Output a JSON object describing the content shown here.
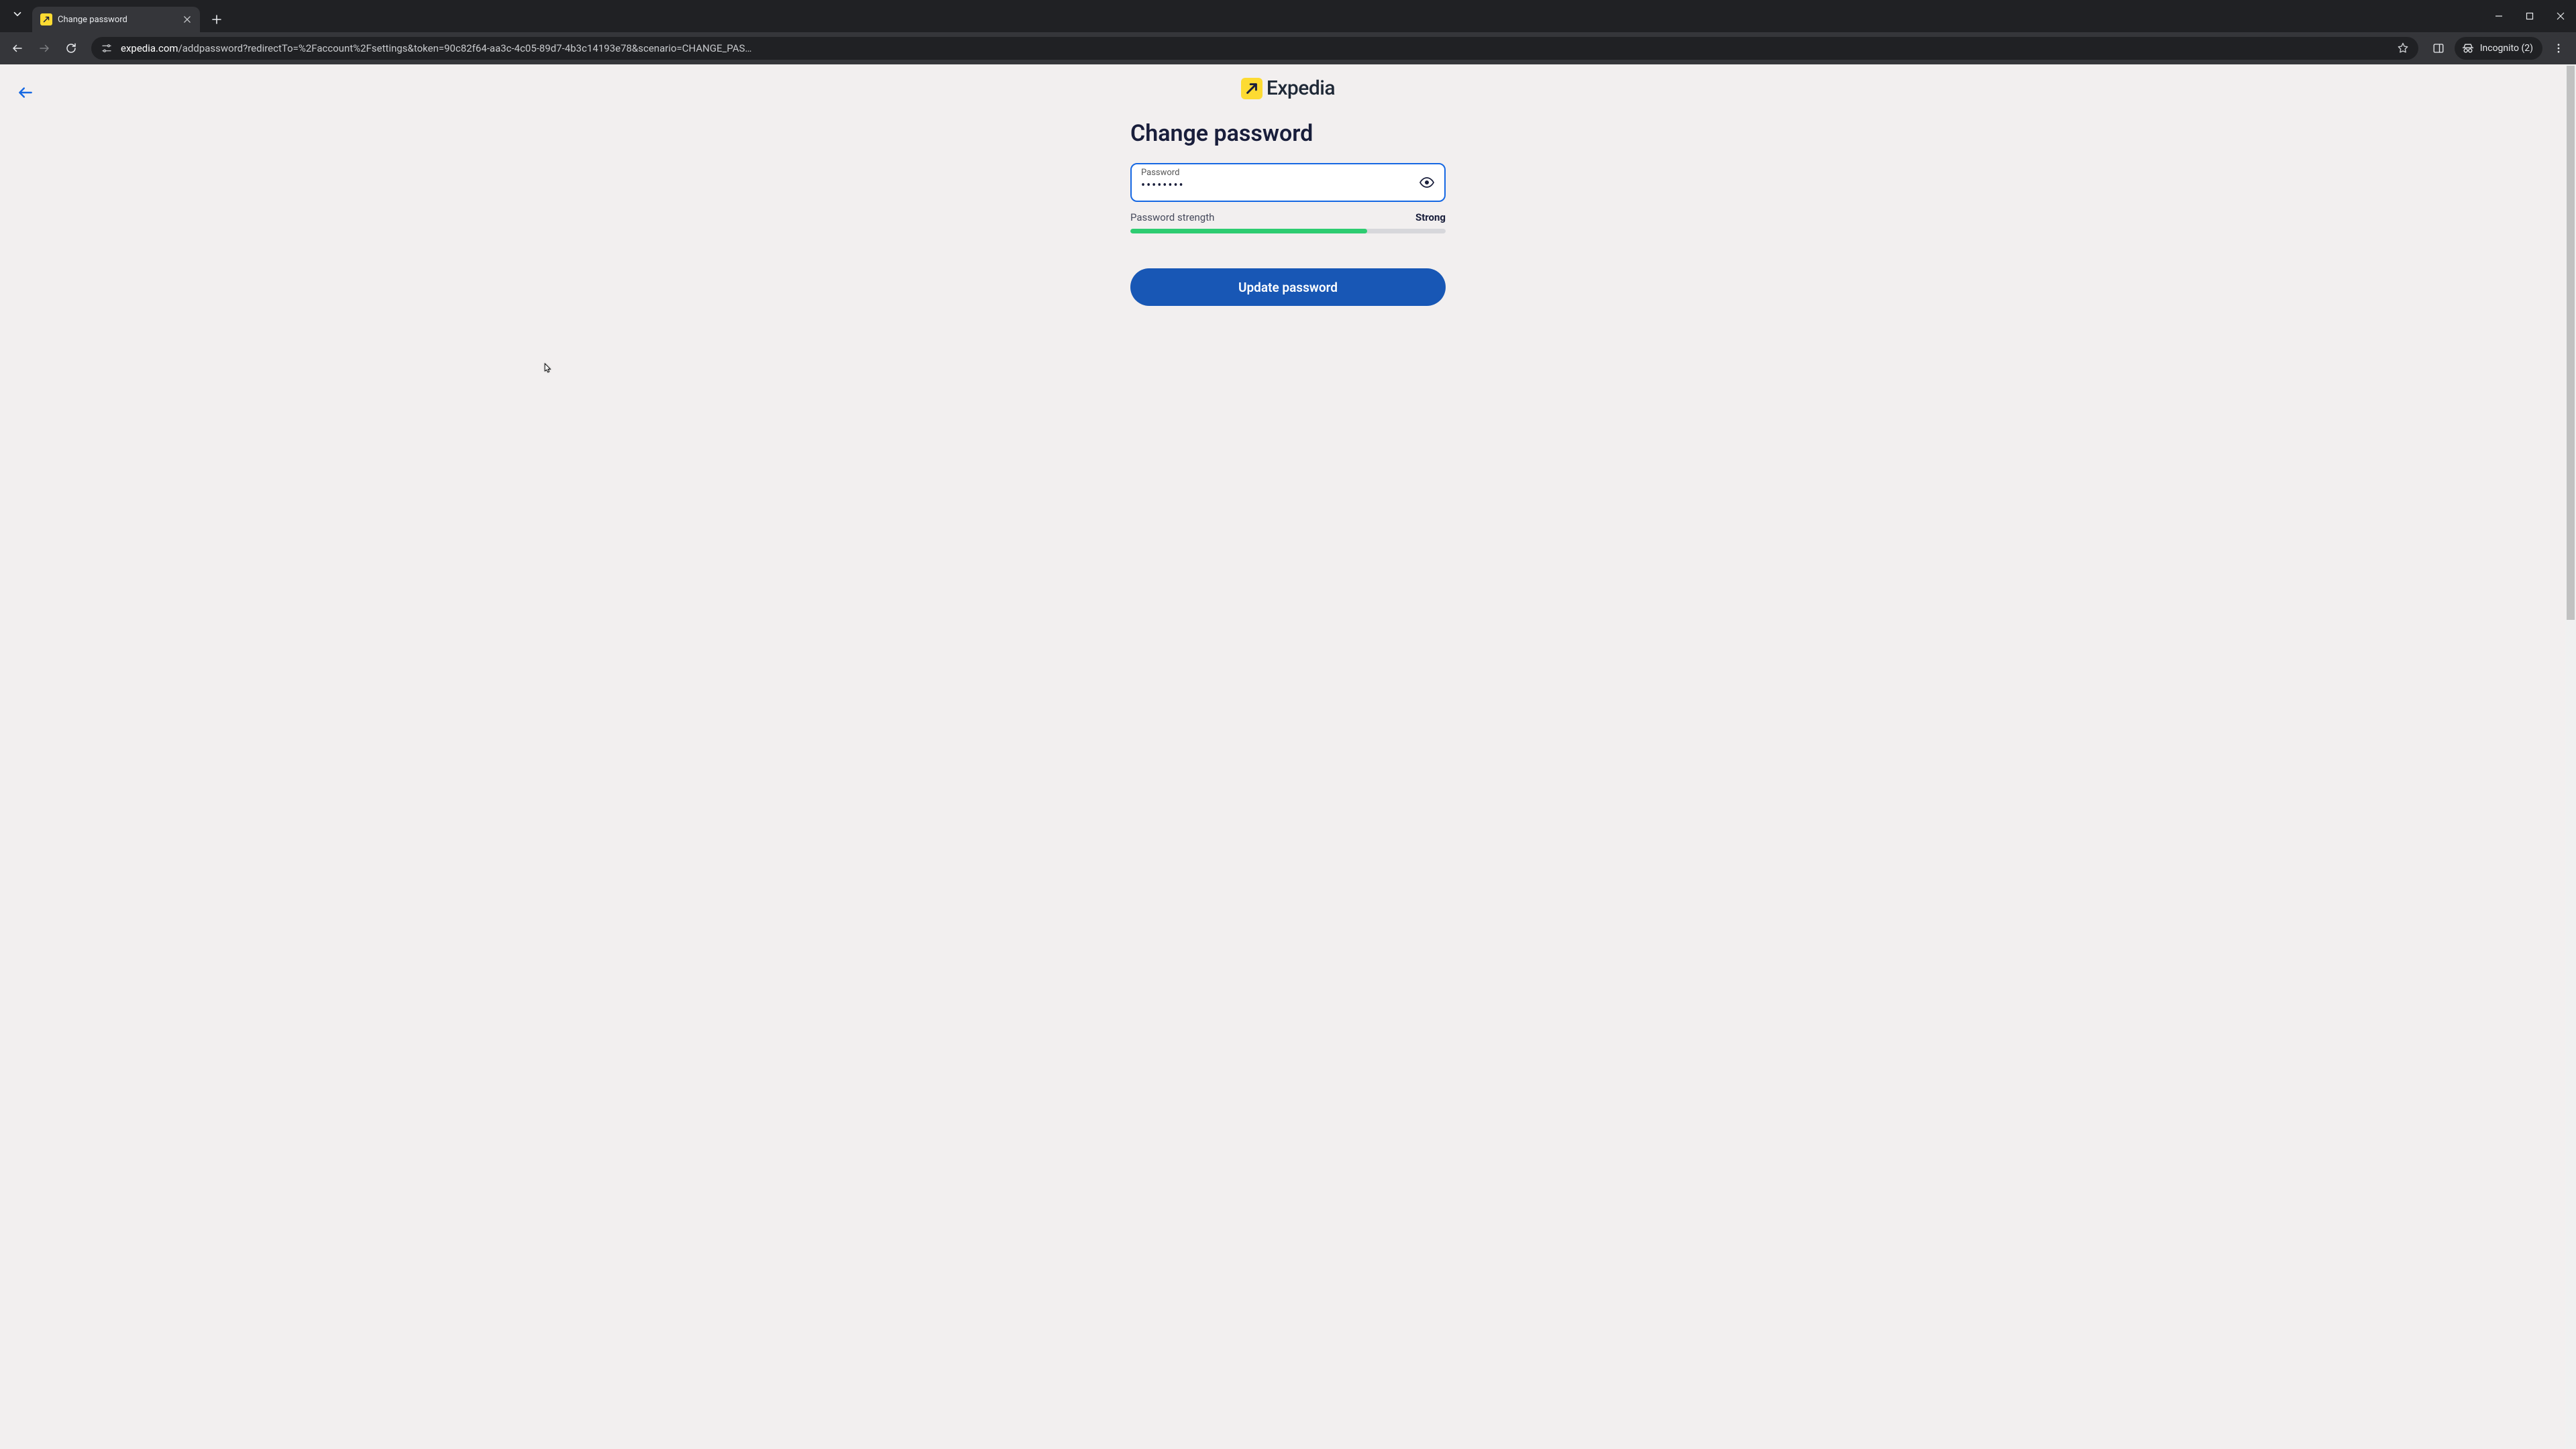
{
  "browser": {
    "tab_title": "Change password",
    "url_domain": "expedia.com",
    "url_path": "/addpassword?redirectTo=%2Faccount%2Fsettings&token=90c82f64-aa3c-4c05-89d7-4b3c14193e78&scenario=CHANGE_PAS…",
    "incognito_label": "Incognito (2)"
  },
  "page": {
    "brand_name": "Expedia",
    "title": "Change password",
    "field_label": "Password",
    "field_value": "••••••••",
    "strength_label": "Password strength",
    "strength_value": "Strong",
    "strength_percent": 75,
    "submit_label": "Update password"
  },
  "colors": {
    "accent_blue": "#1668e3",
    "button_blue": "#1857b5",
    "brand_yellow": "#fddb32",
    "strength_green": "#2ecc71"
  }
}
